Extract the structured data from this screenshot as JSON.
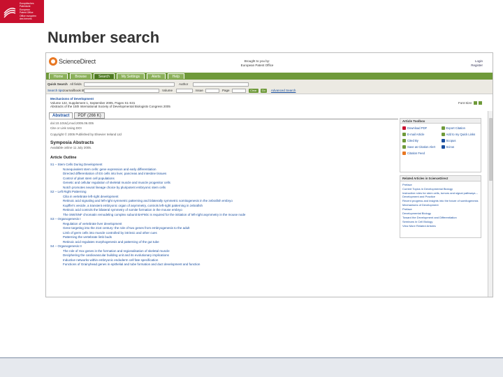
{
  "slide": {
    "title": "Number search",
    "logo_lines": [
      "Europäisches",
      "Patentamt",
      "European",
      "Patent Office",
      "Office européen",
      "des brevets"
    ]
  },
  "sciencedirect": {
    "logo_text": "ScienceDirect",
    "brought_by": [
      "Brought to you by:",
      "European Patent Office"
    ],
    "login": [
      "Login",
      "Register"
    ],
    "nav_tabs": [
      "Home",
      "Browse",
      "Search",
      "My Settings",
      "Alerts",
      "Help"
    ],
    "active_tab": "Search",
    "quick_search": {
      "label": "Quick Search",
      "all_fields_label": "All fields",
      "author_label": "Author",
      "search_tips": "Search tips",
      "journal_book_label": "Journal/book title",
      "volume_label": "Volume",
      "issue_label": "Issue",
      "page_label": "Page",
      "clear_label": "Clear",
      "go_label": "Go",
      "advanced_search": "Advanced Search"
    },
    "journal": {
      "title": "Mechanisms of Development",
      "volume_line": "Volume 122, Supplement 1, September 2005, Pages S1-S31",
      "abstracts_line": "Abstracts of the 15th International Society of Developmental Biologists Congress 2005"
    },
    "font_size_label": "Font Size:",
    "article_tabs": [
      "Abstract",
      "PDF (266 K)"
    ],
    "article_meta": [
      "doi:10.1016/j.mod.2005.06.005",
      "Cite or Link Using DOI",
      "Copyright © 2005 Published by Elsevier Ireland Ltd"
    ],
    "section_title": "Symposia Abstracts",
    "available_online": "Available online 11 July 2005.",
    "outline_title": "Article Outline",
    "outline": [
      {
        "text": "S1 – Stem Cells During Development",
        "level": 0
      },
      {
        "text": "Nonequivalent stem cells: gene expression and early differentiation",
        "level": 1
      },
      {
        "text": "Directed differentiation of ES cells into liver, pancreas and intestine tissues",
        "level": 1
      },
      {
        "text": "Control of plant stem cell populations",
        "level": 1
      },
      {
        "text": "Genetic and cellular regulation of skeletal muscle and muscle progenitor cells",
        "level": 1
      },
      {
        "text": "Notch promotes neural lineage choice by pluripotent embryonic stem cells",
        "level": 1
      },
      {
        "text": "S2 – Left Right Patterning",
        "level": 0
      },
      {
        "text": "Cilia in vertebrate left-right development",
        "level": 1
      },
      {
        "text": "Retinoic acid signaling and left-right symmetric patterning and bilaterally symmetric somitogenesis in the zebrafish embryo",
        "level": 1
      },
      {
        "text": "Kupffer's vesicle, a transient embryonic organ of asymmetry, controls left-right patterning in zebrafish",
        "level": 1
      },
      {
        "text": "Retinoic acid controls the bilateral symmetry of somite formation in the mouse embryo",
        "level": 1
      },
      {
        "text": "The SWI/SNF chromatin remodeling complex subunit BAF60c is required for the initiation of left-right asymmetry in the mouse node",
        "level": 1
      },
      {
        "text": "S3 – Organogenesis I",
        "level": 0
      },
      {
        "text": "Regulation of vertebrate liver development",
        "level": 1
      },
      {
        "text": "Gene targeting into the 21st century: the role of two genes from embryogenesis to the adult",
        "level": 1
      },
      {
        "text": "Limb of germ cells into muscle controlled by intrinsic and other cues",
        "level": 1
      },
      {
        "text": "Patterning the vertebrate limb buds",
        "level": 1
      },
      {
        "text": "Retinoic acid regulates morphogenesis and patterning of the gut tube",
        "level": 1
      },
      {
        "text": "S4 – Organogenesis II",
        "level": 0
      },
      {
        "text": "The role of Hox genes in the formation and regionalisation of skeletal muscle",
        "level": 1
      },
      {
        "text": "Deciphering the cardiovascular building unit and its evolutionary implications",
        "level": 1
      },
      {
        "text": "Inductive networks within embryonic endoderm cell fate specification",
        "level": 1
      },
      {
        "text": "Functions of Grainyhead genes in epithelial and tube formation and duct development and function",
        "level": 1
      }
    ],
    "toolbox": {
      "title": "Article Toolbox",
      "items": [
        {
          "label": "Download PDF",
          "icon": "pdf-icon",
          "color": "#c8102e"
        },
        {
          "label": "Export Citation",
          "icon": "export-icon",
          "color": "#6f9a3a"
        },
        {
          "label": "E-mail Article",
          "icon": "email-icon",
          "color": "#6f9a3a"
        },
        {
          "label": "Add to my Quick Links",
          "icon": "link-icon",
          "color": "#6f9a3a"
        },
        {
          "label": "Cited By",
          "icon": "cited-icon",
          "color": "#6f9a3a"
        },
        {
          "label": "Scopus",
          "icon": "scopus-icon",
          "color": "#1a4fa0"
        },
        {
          "label": "Save as Citation Alert",
          "icon": "alert-icon",
          "color": "#6f9a3a"
        },
        {
          "label": "Scirus",
          "icon": "scirus-icon",
          "color": "#1a4fa0"
        },
        {
          "label": "Citation Feed",
          "icon": "feed-icon",
          "color": "#e87722"
        }
      ]
    },
    "related": {
      "title": "Related Articles in ScienceDirect",
      "items": [
        "Preface",
        "Current Topics in Developmental Biology",
        "Instructive roles for stem cells, tumors and signal pathways – Development and Practice",
        "Recent progress and insights into the future of somitogenesis",
        "Mechanisms of Development",
        "Preface",
        "Developmental Biology",
        "Toward the Development and Differentiation",
        "Seminars in Cell Biology",
        "View More Related Articles"
      ]
    }
  }
}
